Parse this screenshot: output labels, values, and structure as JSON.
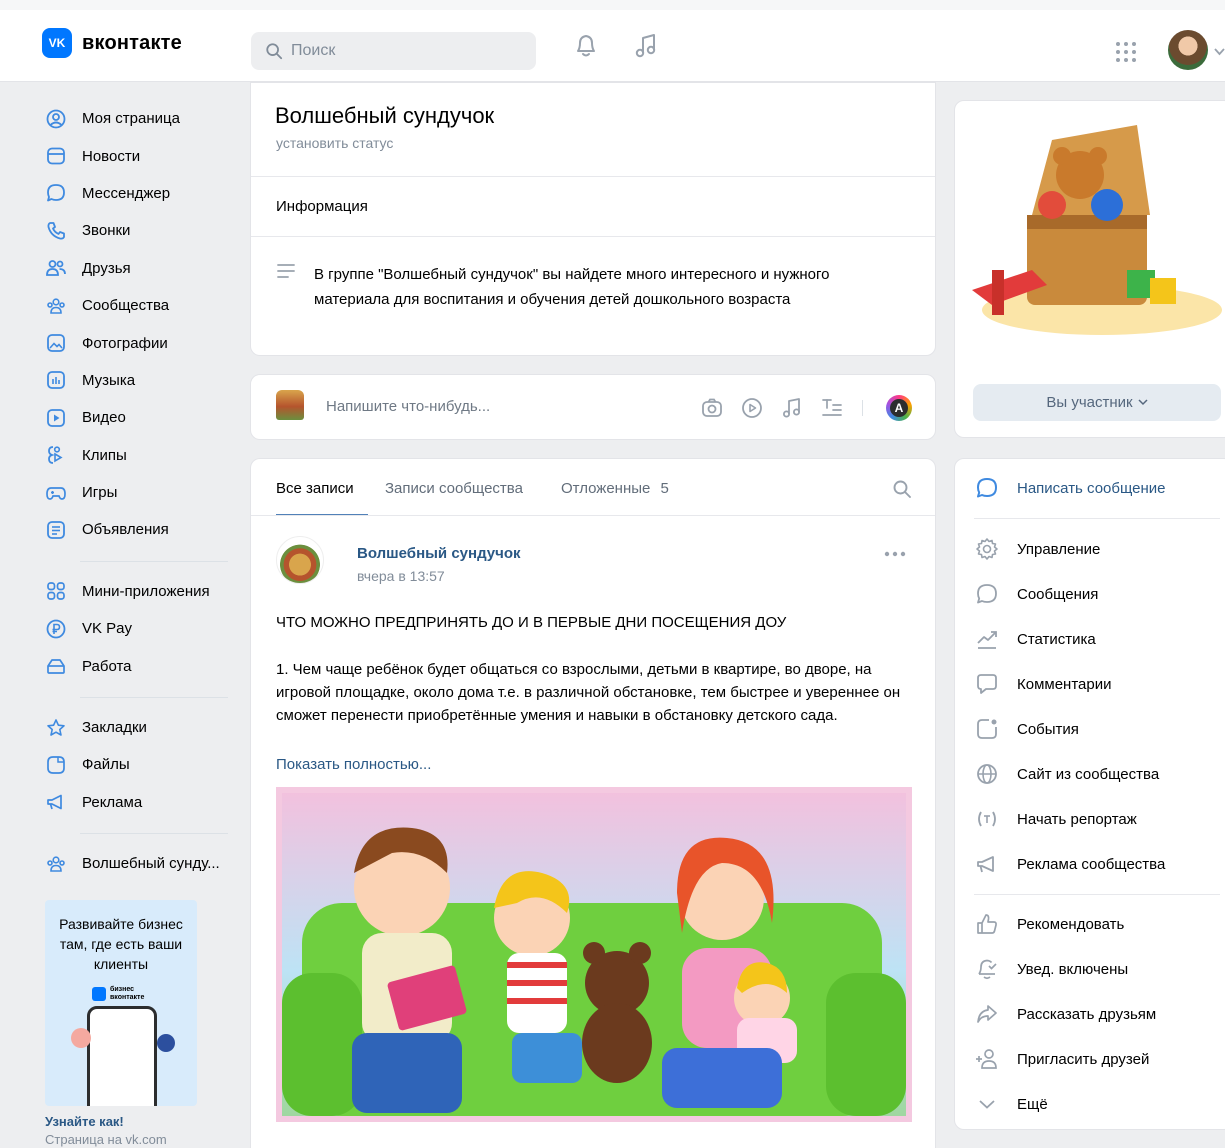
{
  "header": {
    "logo_mark": "VK",
    "logo_text": "вконтакте",
    "search_placeholder": "Поиск"
  },
  "sidebar": {
    "items": [
      {
        "label": "Моя страница",
        "icon": "user-circle-icon"
      },
      {
        "label": "Новости",
        "icon": "news-icon"
      },
      {
        "label": "Мессенджер",
        "icon": "message-icon"
      },
      {
        "label": "Звонки",
        "icon": "phone-icon"
      },
      {
        "label": "Друзья",
        "icon": "friends-icon"
      },
      {
        "label": "Сообщества",
        "icon": "communities-icon"
      },
      {
        "label": "Фотографии",
        "icon": "photos-icon"
      },
      {
        "label": "Музыка",
        "icon": "music-icon"
      },
      {
        "label": "Видео",
        "icon": "video-icon"
      },
      {
        "label": "Клипы",
        "icon": "clips-icon"
      },
      {
        "label": "Игры",
        "icon": "games-icon"
      },
      {
        "label": "Объявления",
        "icon": "ads-board-icon"
      },
      {
        "label": "Мини-приложения",
        "icon": "apps-icon"
      },
      {
        "label": "VK Pay",
        "icon": "vk-pay-icon"
      },
      {
        "label": "Работа",
        "icon": "work-icon"
      },
      {
        "label": "Закладки",
        "icon": "star-icon"
      },
      {
        "label": "Файлы",
        "icon": "file-icon"
      },
      {
        "label": "Реклама",
        "icon": "megaphone-icon"
      },
      {
        "label": "Волшебный сунду...",
        "icon": "communities-icon"
      }
    ],
    "ad": {
      "title": "Развивайте бизнес там, где есть ваши клиенты",
      "brand": "бизнес вконтакте",
      "link": "Узнайте как!",
      "sub": "Страница на vk.com"
    }
  },
  "group": {
    "name": "Волшебный сундучок",
    "status": "установить статус",
    "info_label": "Информация",
    "description": "В группе \"Волшебный сундучок\" вы найдете много интересного и нужного материала для воспитания и обучения детей дошкольного возраста"
  },
  "compose": {
    "placeholder": "Напишите что-нибудь...",
    "avatar_letter": "A"
  },
  "wall": {
    "tabs": [
      {
        "label": "Все записи",
        "active": true
      },
      {
        "label": "Записи сообщества",
        "active": false
      },
      {
        "label": "Отложенные",
        "count": "5",
        "active": false
      }
    ]
  },
  "post": {
    "author": "Волшебный сундучок",
    "date": "вчера в 13:57",
    "heading": "ЧТО МОЖНО ПРЕДПРИНЯТЬ ДО И В ПЕРВЫЕ ДНИ ПОСЕЩЕНИЯ ДОУ",
    "body": "1. Чем чаще ребёнок будет общаться со взрослыми, детьми в квартире, во дворе, на игровой площадке, около дома т.е. в различной обстановке, тем быстрее и увереннее он сможет перенести приобретённые умения и навыки в обстановку детского сада.",
    "show_more": "Показать полностью..."
  },
  "right": {
    "member_button": "Вы участник",
    "menu": [
      {
        "label": "Написать сообщение",
        "icon": "message-icon",
        "primary": true
      },
      {
        "label": "Управление",
        "icon": "gear-icon"
      },
      {
        "label": "Сообщения",
        "icon": "message-icon"
      },
      {
        "label": "Статистика",
        "icon": "stats-icon"
      },
      {
        "label": "Комментарии",
        "icon": "comment-icon"
      },
      {
        "label": "События",
        "icon": "event-icon"
      },
      {
        "label": "Сайт из сообщества",
        "icon": "globe-icon"
      },
      {
        "label": "Начать репортаж",
        "icon": "broadcast-icon"
      },
      {
        "label": "Реклама сообщества",
        "icon": "megaphone-icon"
      },
      {
        "label": "Рекомендовать",
        "icon": "thumb-up-icon"
      },
      {
        "label": "Увед. включены",
        "icon": "bell-check-icon"
      },
      {
        "label": "Рассказать друзьям",
        "icon": "share-icon"
      },
      {
        "label": "Пригласить друзей",
        "icon": "add-user-icon"
      },
      {
        "label": "Ещё",
        "icon": "chevron-down-icon"
      }
    ]
  },
  "colors": {
    "accent": "#2a5885",
    "brand": "#0077ff",
    "icon_blue": "#3f8ae0"
  }
}
